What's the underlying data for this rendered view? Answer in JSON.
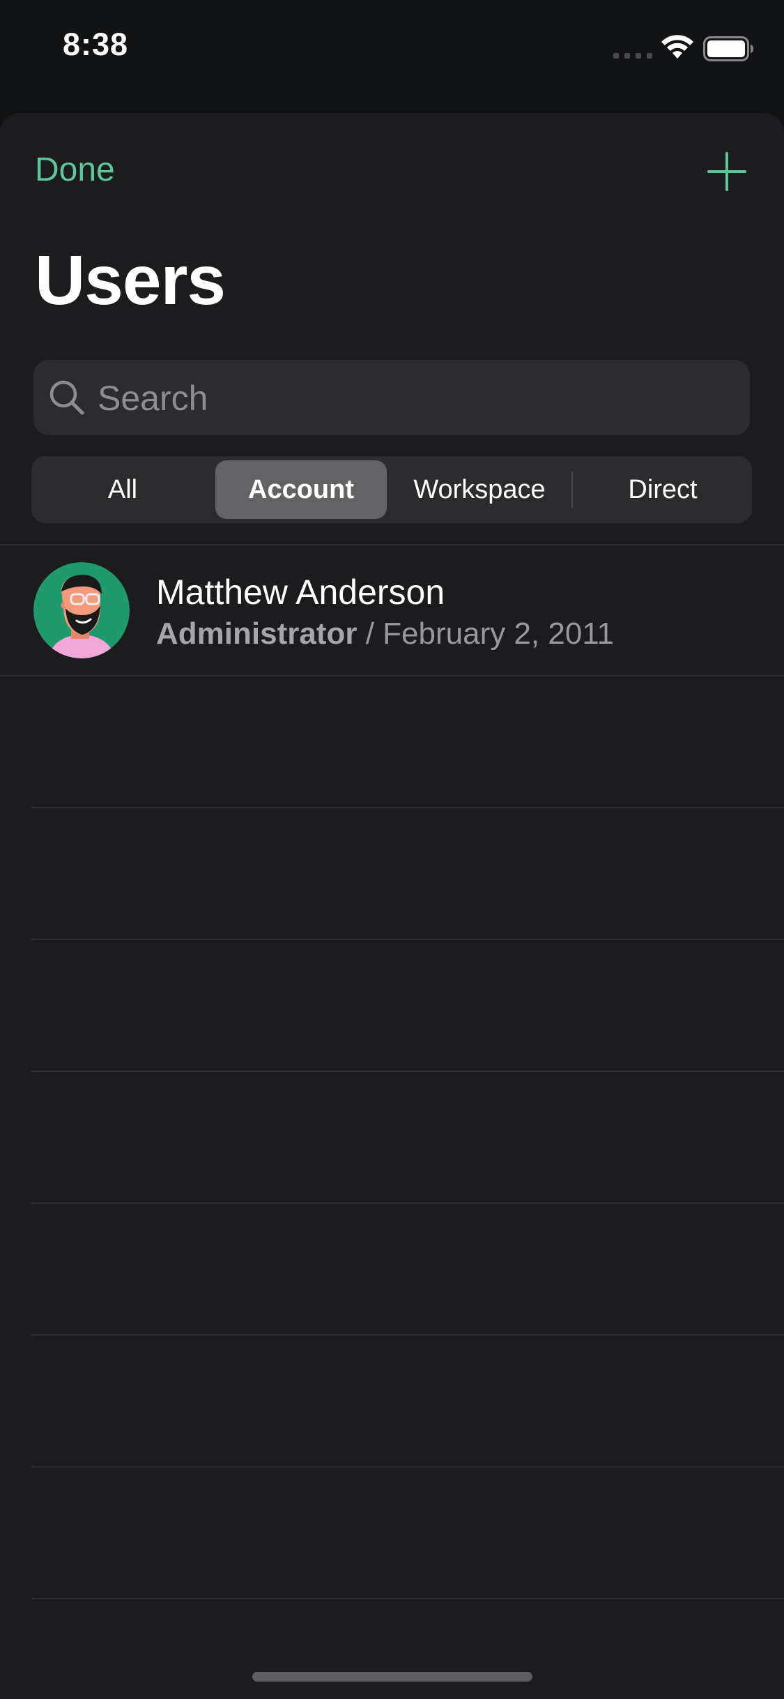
{
  "status_bar": {
    "time": "8:38",
    "wifi_icon": "wifi-icon",
    "battery_icon": "battery-icon"
  },
  "nav": {
    "done_label": "Done",
    "add_icon": "plus-icon",
    "title": "Users"
  },
  "search": {
    "placeholder": "Search",
    "value": ""
  },
  "segments": [
    {
      "label": "All",
      "selected": false
    },
    {
      "label": "Account",
      "selected": true
    },
    {
      "label": "Workspace",
      "selected": false
    },
    {
      "label": "Direct",
      "selected": false
    }
  ],
  "users": [
    {
      "name": "Matthew Anderson",
      "role": "Administrator",
      "separator": " / ",
      "date": "February 2, 2011",
      "avatar_icon": "avatar-illustration"
    }
  ],
  "colors": {
    "accent": "#5cc79a",
    "background": "#1c1c1e",
    "selected_segment": "#636366"
  }
}
